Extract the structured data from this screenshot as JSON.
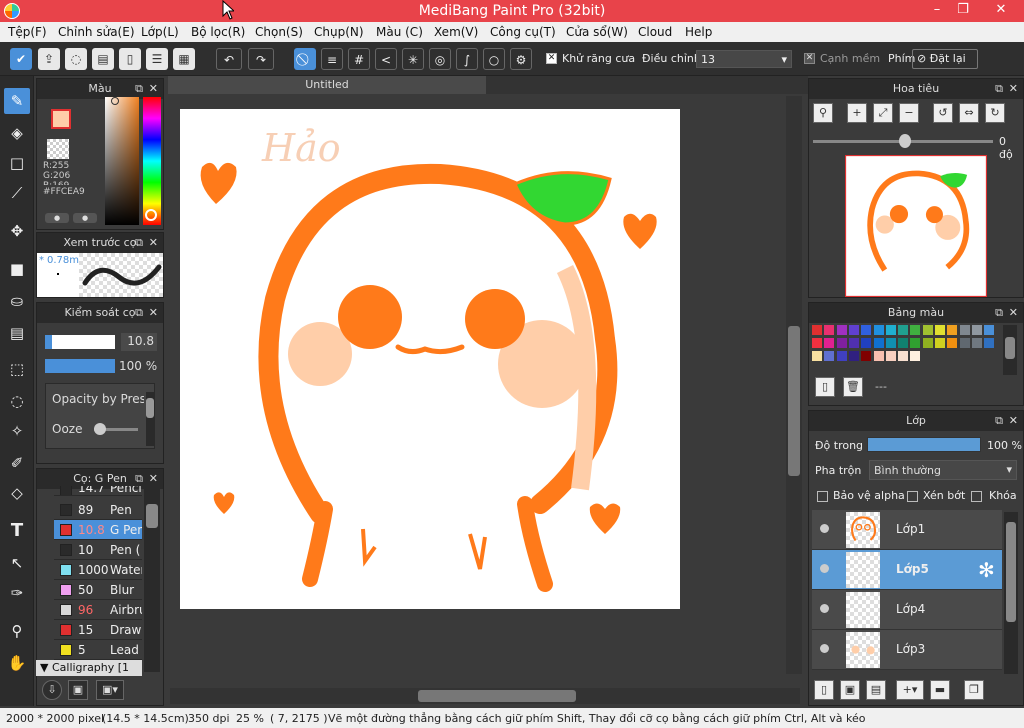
{
  "window": {
    "title": "MediBang Paint Pro (32bit)",
    "minimize": "–",
    "maximize": "❐",
    "close": "✕"
  },
  "menu": [
    "Tệp(F)",
    "Chỉnh sửa(E)",
    "Lớp(L)",
    "Bộ lọc(R)",
    "Chọn(S)",
    "Chụp(N)",
    "Màu (C)",
    "Xem(V)",
    "Công cụ(T)",
    "Cửa sổ(W)",
    "Cloud",
    "Help"
  ],
  "toolbar": {
    "antialias_label": "Khử răng cưa",
    "adjust_label": "Điều chỉnh",
    "adjust_value": "13",
    "soft_edge_label": "Cạnh mềm",
    "key_label": "Phím",
    "reset_label": "Đặt lại"
  },
  "color_panel": {
    "title": "Màu",
    "r": "R:255",
    "g": "G:206",
    "b": "B:169",
    "hex": "#FFCEA9",
    "fg_color": "#FFCEA9"
  },
  "brush_preview": {
    "title": "Xem trước cọ",
    "size": "0.78m"
  },
  "brush_control": {
    "title": "Kiểm soát cọ",
    "size": "10.8",
    "opacity": "100 %",
    "size_fill": 0.1,
    "opacity_fill": 1.0,
    "opt1": "Opacity by Press",
    "opt2": "Ooze"
  },
  "brush_list": {
    "title": "Cọ: G Pen",
    "items": [
      {
        "size": "14.7",
        "name": "Pencil",
        "color": "#2a2a2a"
      },
      {
        "size": "89",
        "name": "Pen",
        "color": "#2a2a2a"
      },
      {
        "size": "10.8",
        "name": "G Pen",
        "color": "#e03030"
      },
      {
        "size": "10",
        "name": "Pen (",
        "color": "#2a2a2a"
      },
      {
        "size": "1000",
        "name": "Water",
        "color": "#7fe0f0"
      },
      {
        "size": "50",
        "name": "Blur",
        "color": "#f0a0f0"
      },
      {
        "size": "96",
        "name": "Airbru",
        "color": "#d8d8d8"
      },
      {
        "size": "15",
        "name": "Drawi",
        "color": "#e03030"
      },
      {
        "size": "5",
        "name": "Lead",
        "color": "#f0e020"
      }
    ],
    "group": "Calligraphy [1"
  },
  "document": {
    "tab": "Untitled",
    "signature": "Hảo"
  },
  "navigator": {
    "title": "Hoa tiêu",
    "angle": "0 độ"
  },
  "palette": {
    "title": "Bảng màu",
    "none_label": "---",
    "colors": [
      "#e03030",
      "#e83070",
      "#a030c0",
      "#6040d0",
      "#3060e0",
      "#2090e0",
      "#20b0d0",
      "#20a090",
      "#40b040",
      "#a0c030",
      "#e0e030",
      "#f0a020",
      "#808890",
      "#9098a0",
      "#4a90d9",
      "#f03040",
      "#e02090",
      "#8020a0",
      "#5030b0",
      "#2040c0",
      "#1070d0",
      "#1090b0",
      "#108070",
      "#30a030",
      "#90b020",
      "#d0d020",
      "#f09010",
      "#606870",
      "#707880",
      "#3070c0",
      "#f8e0a0",
      "#6070d0",
      "#4040c0",
      "#302080",
      "#800000",
      "#f8c0b0",
      "#f8d0c0",
      "#f8e0d0",
      "#fff0e0"
    ]
  },
  "layers": {
    "title": "Lớp",
    "opacity_label": "Độ trong",
    "opacity_value": "100 %",
    "blend_label": "Pha trộn",
    "blend_value": "Bình thường",
    "protect_alpha": "Bảo vệ alpha",
    "clipping": "Xén bớt",
    "lock": "Khóa",
    "items": [
      "Lớp1",
      "Lớp5",
      "Lớp4",
      "Lớp3"
    ]
  },
  "status": {
    "size": "2000 * 2000 pixel",
    "cm": "(14.5 * 14.5cm)",
    "dpi": "350 dpi",
    "zoom": "25 %",
    "coords": "( 7, 2175 )",
    "hint": "Vẽ một đường thẳng bằng cách giữ phím Shift, Thay đổi cỡ cọ bằng cách giữ phím Ctrl, Alt và kéo"
  }
}
